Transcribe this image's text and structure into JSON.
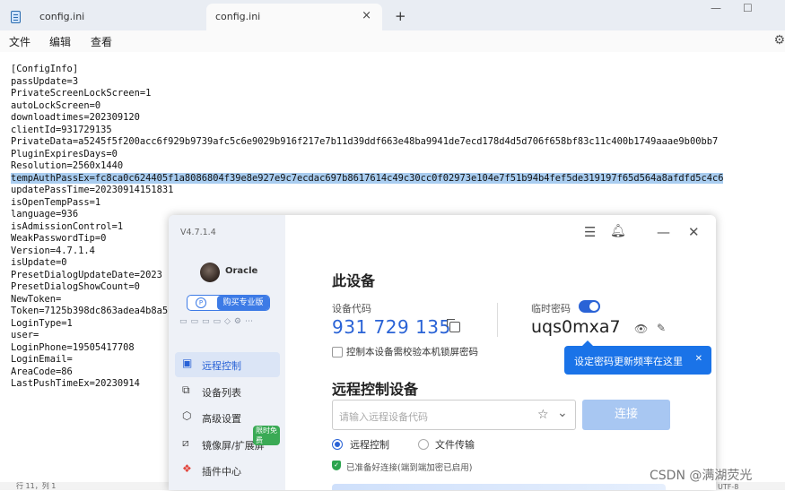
{
  "tabs": [
    {
      "label": "config.ini"
    },
    {
      "label": "config.ini",
      "close_icon": "×"
    }
  ],
  "new_tab_icon": "+",
  "window_controls": {
    "minimize": "—",
    "maximize": "☐"
  },
  "menu": [
    "文件",
    "编辑",
    "查看"
  ],
  "file_lines": [
    "[ConfigInfo]",
    "passUpdate=3",
    "PrivateScreenLockScreen=1",
    "autoLockScreen=0",
    "downloadtimes=202309120",
    "clientId=931729135",
    "PrivateData=a5245f5f200acc6f929b9739afc5c6e9029b916f217e7b11d39ddf663e48ba9941de7ecd178d4d5d706f658bf83c11c400b1749aaae9b00bb7",
    "PluginExpiresDays=0",
    "Resolution=2560x1440",
    "tempAuthPassEx=fc8ca0c624405f1a8086804f39e8e927e9c7ecdac697b8617614c49c30cc0f02973e104e7f51b94b4fef5de319197f65d564a8afdfd5c4c6",
    "updatePassTime=20230914151831",
    "isOpenTempPass=1",
    "language=936",
    "isAdmissionControl=1",
    "WeakPasswordTip=0",
    "Version=4.7.1.4",
    "isUpdate=0",
    "PresetDialogUpdateDate=2023",
    "PresetDialogShowCount=0",
    "NewToken=",
    "Token=7125b398dc863adea4b8a5",
    "LoginType=1",
    "user=",
    "LoginPhone=19505417708",
    "LoginEmail=",
    "AreaCode=86",
    "LastPushTimeEx=20230914"
  ],
  "selected_line_index": 9,
  "status": {
    "position": "行 11，列 1",
    "encoding": "UTF-8"
  },
  "app": {
    "version": "V4.7.1.4",
    "user_name": "Oracle",
    "pro_button": "购买专业版",
    "nav": [
      {
        "label": "远程控制",
        "icon": "remote-control-icon",
        "active": true
      },
      {
        "label": "设备列表",
        "icon": "device-list-icon",
        "active": false
      },
      {
        "label": "高级设置",
        "icon": "advanced-settings-icon",
        "active": false
      },
      {
        "label": "镜像屏/扩展屏",
        "icon": "mirror-screen-icon",
        "active": false,
        "badge": "限时免费"
      },
      {
        "label": "插件中心",
        "icon": "plugin-center-icon",
        "active": false
      }
    ],
    "this_device_title": "此设备",
    "device_code_label": "设备代码",
    "device_code": "931 729 135",
    "temp_password_label": "临时密码",
    "temp_password": "uqs0mxa7",
    "temp_password_enabled": true,
    "lock_screen_checkbox_label": "控制本设备需校验本机锁屏密码",
    "tooltip_text": "设定密码更新频率在这里",
    "remote_title": "远程控制设备",
    "remote_input_placeholder": "请输入远程设备代码",
    "connect_button": "连接",
    "mode_options": [
      {
        "label": "远程控制",
        "selected": true
      },
      {
        "label": "文件传输",
        "selected": false
      }
    ],
    "ready_text": "已准备好连接(端到端加密已启用)"
  },
  "watermark": "CSDN @满湖荧光"
}
